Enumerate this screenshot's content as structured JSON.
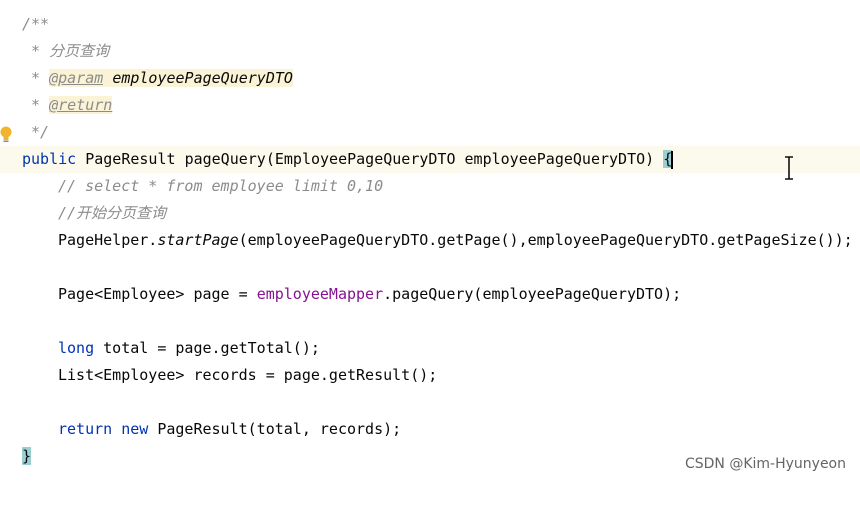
{
  "lines": [
    {
      "text": "/**"
    },
    {
      "text": " * 分页查询"
    },
    {
      "prefix": " * ",
      "tag": "@param",
      "param": "employeePageQueryDTO"
    },
    {
      "prefix": " * ",
      "tag": "@return"
    },
    {
      "text": " */"
    },
    {
      "kw": "public",
      "type": "PageResult",
      "method": "pageQuery",
      "signature": "(EmployeePageQueryDTO employeePageQueryDTO) ",
      "brace": "{"
    },
    {
      "text": "// select * from employee limit 0,10"
    },
    {
      "text": "//开始分页查询"
    },
    {
      "cls": "PageHelper.",
      "call": "startPage",
      "rest": "(employeePageQueryDTO.getPage(),employeePageQueryDTO.getPageSize());"
    },
    {
      "pre": "Page<Employee> page = ",
      "field": "employeeMapper",
      "rest": ".pageQuery(employeePageQueryDTO);"
    },
    {
      "kw": "long",
      "rest": " total = page.getTotal();"
    },
    {
      "text": "List<Employee> records = page.getResult();"
    },
    {
      "kw": "return",
      "kw2": "new",
      "rest": " PageResult(total, records);"
    },
    {
      "brace": "}"
    }
  ],
  "watermark": "CSDN @Kim-Hyunyeon",
  "colors": {
    "keyword": "#0033b3",
    "comment": "#8c8c8c",
    "field": "#871094",
    "current_line": "#fcfaed",
    "brace_match": "#99cfd3"
  }
}
